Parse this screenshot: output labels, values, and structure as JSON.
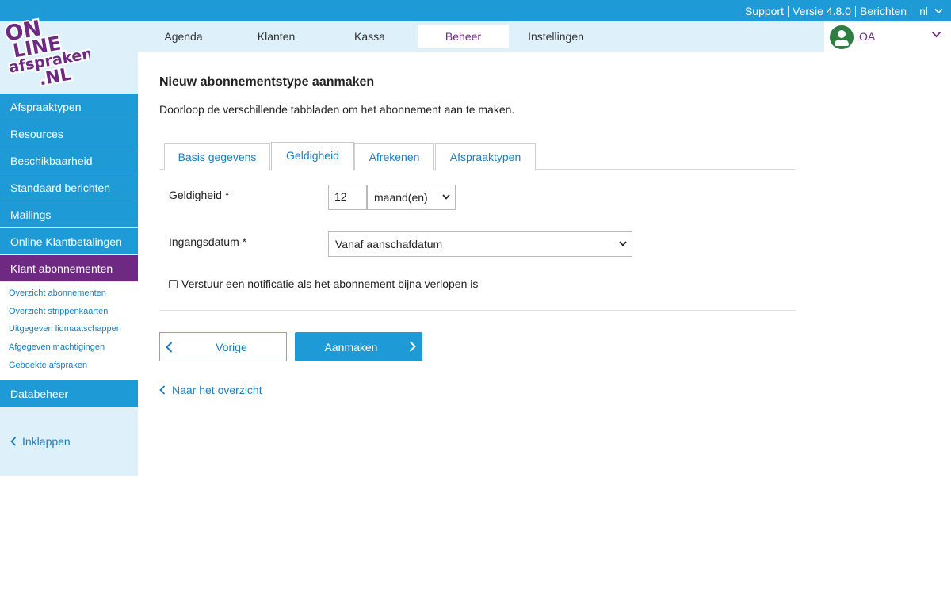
{
  "topbar": {
    "support": "Support",
    "version": "Versie 4.8.0",
    "messages": "Berichten",
    "language": "nl"
  },
  "logo": {
    "line1": "ON",
    "line2": "LINE",
    "line3": "afspraken",
    "line4": ".NL"
  },
  "nav": {
    "items": [
      {
        "label": "Agenda"
      },
      {
        "label": "Klanten"
      },
      {
        "label": "Kassa"
      },
      {
        "label": "Beheer"
      },
      {
        "label": "Instellingen"
      }
    ],
    "active": "Beheer"
  },
  "user": {
    "initials": "OA"
  },
  "sidebar": {
    "items": [
      {
        "label": "Afspraaktypen"
      },
      {
        "label": "Resources"
      },
      {
        "label": "Beschikbaarheid"
      },
      {
        "label": "Standaard berichten"
      },
      {
        "label": "Mailings"
      },
      {
        "label": "Online Klantbetalingen"
      },
      {
        "label": "Klant abonnementen"
      }
    ],
    "subitems": [
      {
        "label": "Overzicht abonnementen"
      },
      {
        "label": "Overzicht strippenkaarten"
      },
      {
        "label": "Uitgegeven lidmaatschappen"
      },
      {
        "label": "Afgegeven machtigingen"
      },
      {
        "label": "Geboekte afspraken"
      }
    ],
    "last_item": "Databeheer",
    "collapse": "Inklappen"
  },
  "main": {
    "title": "Nieuw abonnementstype aanmaken",
    "intro": "Doorloop de verschillende tabbladen om het abonnement aan te maken.",
    "tabs": [
      {
        "label": "Basis gegevens"
      },
      {
        "label": "Geldigheid"
      },
      {
        "label": "Afrekenen"
      },
      {
        "label": "Afspraaktypen"
      }
    ],
    "active_tab": "Geldigheid",
    "validity_label": "Geldigheid *",
    "validity_value": "12",
    "validity_unit": "maand(en)",
    "start_label": "Ingangsdatum *",
    "start_value": "Vanaf aanschafdatum",
    "notify_label": "Verstuur een notificatie als het abonnement bijna verlopen is",
    "notify_checked": false,
    "prev_button": "Vorige",
    "create_button": "Aanmaken",
    "back_link": "Naar het overzicht"
  },
  "colors": {
    "primary": "#1e9bd7",
    "accent": "#6e2a83",
    "nav_bg": "#def1fb",
    "link": "#1a7dc0",
    "avatar": "#2e7d42"
  }
}
